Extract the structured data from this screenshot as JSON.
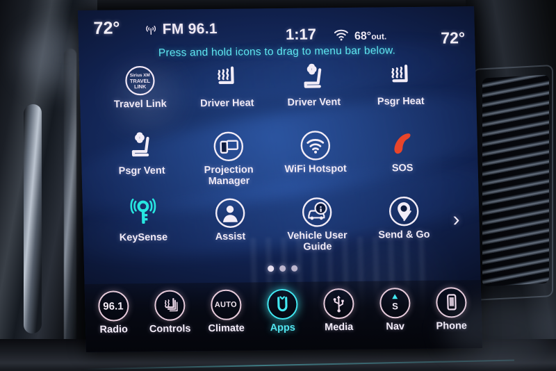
{
  "device": {
    "name": "Uconnect touchscreen",
    "accent_cyan": "#52e4ee",
    "icon_white": "#f0eaf6",
    "sos_red": "#e8452a"
  },
  "status_bar": {
    "temp_left": "72°",
    "source_icon": "broadcast-icon",
    "source_label": "FM 96.1",
    "clock": "1:17",
    "wifi_icon": "wifi-icon",
    "outside_temp": "68°",
    "outside_suffix": "out.",
    "temp_right": "72°"
  },
  "hint": {
    "text": "Press and hold icons to drag to menu bar below."
  },
  "apps": {
    "rows": [
      [
        {
          "label": "Travel Link",
          "icon": "siriusxm-travel-link-icon",
          "badge_lines": [
            "Sirius XM",
            "TRAVEL",
            "LINK"
          ],
          "color": "white"
        },
        {
          "label": "Driver Heat",
          "icon": "seat-heat-icon",
          "color": "white"
        },
        {
          "label": "Driver Vent",
          "icon": "seat-vent-icon",
          "color": "white"
        },
        {
          "label": "Psgr Heat",
          "icon": "seat-heat-icon",
          "color": "white"
        }
      ],
      [
        {
          "label": "Psgr Vent",
          "icon": "seat-vent-icon",
          "color": "white"
        },
        {
          "label": "Projection Manager",
          "icon": "projection-manager-icon",
          "color": "white"
        },
        {
          "label": "WiFi Hotspot",
          "icon": "wifi-hotspot-icon",
          "color": "white"
        },
        {
          "label": "SOS",
          "icon": "sos-phone-icon",
          "color": "red"
        }
      ],
      [
        {
          "label": "KeySense",
          "icon": "keysense-icon",
          "color": "cyan"
        },
        {
          "label": "Assist",
          "icon": "assist-person-icon",
          "color": "white"
        },
        {
          "label": "Vehicle User Guide",
          "icon": "vehicle-user-guide-icon",
          "color": "white"
        },
        {
          "label": "Send & Go",
          "icon": "send-and-go-pin-icon",
          "color": "white"
        }
      ]
    ],
    "next_page_icon": "chevron-right-icon",
    "page_dots": 3,
    "page_active_index": 0
  },
  "menu_bar": {
    "items": [
      {
        "label": "Radio",
        "icon": "radio-frequency-icon",
        "value": "96.1",
        "active": false
      },
      {
        "label": "Controls",
        "icon": "controls-seat-icon",
        "active": false
      },
      {
        "label": "Climate",
        "icon": "climate-auto-icon",
        "value": "AUTO",
        "active": false
      },
      {
        "label": "Apps",
        "icon": "uconnect-apps-icon",
        "active": true
      },
      {
        "label": "Media",
        "icon": "usb-media-icon",
        "active": false
      },
      {
        "label": "Nav",
        "icon": "nav-compass-icon",
        "value": "S",
        "active": false
      },
      {
        "label": "Phone",
        "icon": "phone-device-icon",
        "active": false
      }
    ]
  }
}
